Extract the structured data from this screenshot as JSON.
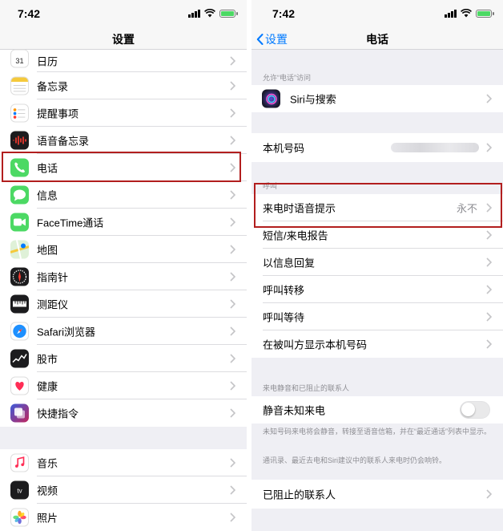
{
  "left": {
    "status": {
      "time": "7:42"
    },
    "nav": {
      "title": "设置"
    },
    "items": [
      {
        "label": "日历",
        "icon": "calendar-icon"
      },
      {
        "label": "备忘录",
        "icon": "notes-icon"
      },
      {
        "label": "提醒事项",
        "icon": "reminders-icon"
      },
      {
        "label": "语音备忘录",
        "icon": "voice-memos-icon"
      },
      {
        "label": "电话",
        "icon": "phone-icon"
      },
      {
        "label": "信息",
        "icon": "messages-icon"
      },
      {
        "label": "FaceTime通话",
        "icon": "facetime-icon"
      },
      {
        "label": "地图",
        "icon": "maps-icon"
      },
      {
        "label": "指南针",
        "icon": "compass-icon"
      },
      {
        "label": "测距仪",
        "icon": "measure-icon"
      },
      {
        "label": "Safari浏览器",
        "icon": "safari-icon"
      },
      {
        "label": "股市",
        "icon": "stocks-icon"
      },
      {
        "label": "健康",
        "icon": "health-icon"
      },
      {
        "label": "快捷指令",
        "icon": "shortcuts-icon"
      },
      {
        "label": "音乐",
        "icon": "music-icon"
      },
      {
        "label": "视频",
        "icon": "tv-icon"
      },
      {
        "label": "照片",
        "icon": "photos-icon"
      }
    ]
  },
  "right": {
    "status": {
      "time": "7:42"
    },
    "nav": {
      "back_label": "设置",
      "title": "电话"
    },
    "sections": {
      "allow_access_header": "允许“电话”访问",
      "siri": "Siri与搜索",
      "my_number": "本机号码",
      "calls_header": "呼叫",
      "announce_calls": "来电时语音提示",
      "announce_calls_value": "永不",
      "sms_call_reporting": "短信/来电报告",
      "respond_with_text": "以信息回复",
      "call_forwarding": "呼叫转移",
      "call_waiting": "呼叫等待",
      "show_caller_id": "在被叫方显示本机号码",
      "silence_header": "来电静音和已阻止的联系人",
      "silence_unknown": "静音未知来电",
      "silence_note_1": "未知号码来电将会静音，转接至语音信箱，并在“最近通话”列表中显示。",
      "silence_note_2": "通讯录、最近去电和Siri建议中的联系人来电时仍会响铃。",
      "blocked_contacts": "已阻止的联系人"
    },
    "silence_unknown_on": false
  },
  "colors": {
    "highlight": "#b21e1e",
    "ios_blue": "#007aff",
    "phone_green": "#4cd964"
  }
}
